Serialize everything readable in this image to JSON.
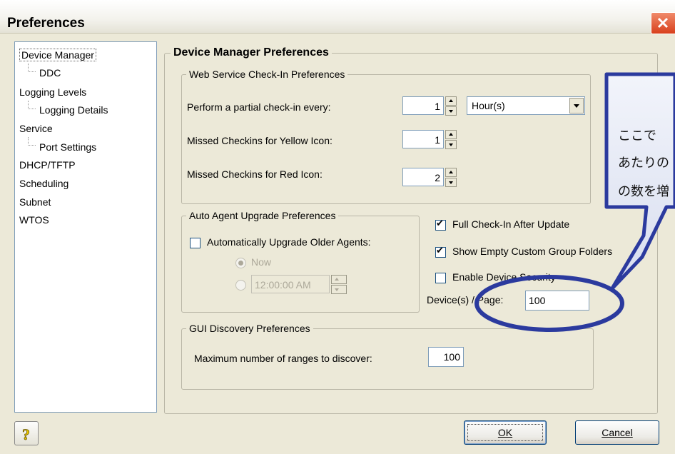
{
  "window": {
    "title": "Preferences"
  },
  "tree": {
    "items": [
      {
        "label": "Device Manager",
        "level": 0,
        "selected": true
      },
      {
        "label": "DDC",
        "level": 1
      },
      {
        "label": "Logging Levels",
        "level": 0
      },
      {
        "label": "Logging Details",
        "level": 1
      },
      {
        "label": "Service",
        "level": 0
      },
      {
        "label": "Port Settings",
        "level": 1
      },
      {
        "label": "DHCP/TFTP",
        "level": 0
      },
      {
        "label": "Scheduling",
        "level": 0
      },
      {
        "label": "Subnet",
        "level": 0
      },
      {
        "label": "WTOS",
        "level": 0
      }
    ]
  },
  "main": {
    "title": "Device Manager Preferences",
    "web_service": {
      "title": "Web Service Check-In Preferences",
      "partial_label": "Perform a partial check-in every:",
      "partial_value": "1",
      "partial_unit": "Hour(s)",
      "yellow_label": "Missed Checkins for Yellow Icon:",
      "yellow_value": "1",
      "red_label": "Missed Checkins for Red Icon:",
      "red_value": "2"
    },
    "auto_upgrade": {
      "title": "Auto Agent Upgrade Preferences",
      "auto_label": "Automatically Upgrade Older Agents:",
      "auto_checked": false,
      "now_label": "Now",
      "time_value": "12:00:00 AM"
    },
    "options": {
      "full_checkin_label": "Full Check-In After Update",
      "full_checkin_checked": true,
      "empty_folders_label": "Show Empty Custom Group Folders",
      "empty_folders_checked": true,
      "device_security_label": "Enable Device Security",
      "device_security_checked": false,
      "devices_per_page_label": "Device(s) / Page:",
      "devices_per_page_value": "100"
    },
    "gui_discovery": {
      "title": "GUI Discovery Preferences",
      "max_ranges_label": "Maximum number of ranges to discover:",
      "max_ranges_value": "100"
    }
  },
  "buttons": {
    "ok": "OK",
    "cancel": "Cancel",
    "help_icon": "question-mark-icon"
  },
  "callout": {
    "lines": [
      "ここで",
      "あたりの",
      "の数を増"
    ],
    "color": "#2b3a9e"
  }
}
